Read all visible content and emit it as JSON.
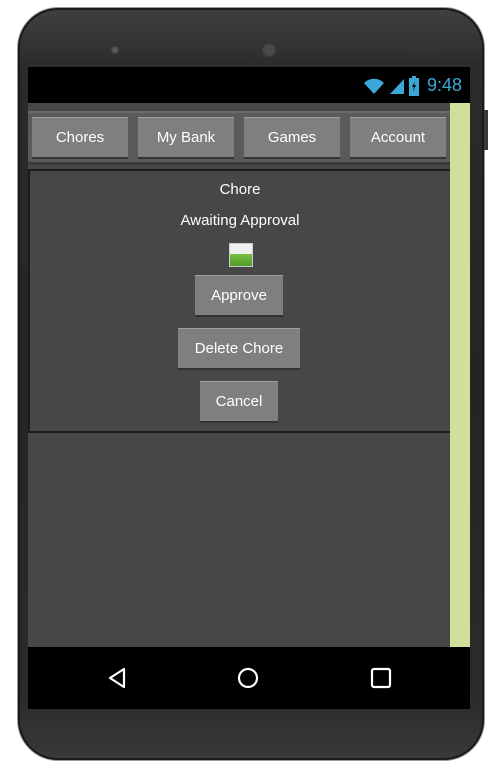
{
  "status": {
    "time": "9:48"
  },
  "nav": {
    "tabs": [
      "Chores",
      "My Bank",
      "Games",
      "Account"
    ]
  },
  "chore": {
    "name": "Chore",
    "status": "Awaiting Approval",
    "actions": {
      "approve": "Approve",
      "delete": "Delete Chore",
      "cancel": "Cancel"
    }
  },
  "icons": [
    "wifi-icon",
    "cell-signal-icon",
    "battery-icon",
    "image-icon",
    "back-icon",
    "home-icon",
    "recents-icon"
  ],
  "colors": {
    "accent": "#3aa9d8",
    "side_bar": "#cfe09c",
    "button": "#7f7f7f",
    "background": "#474747"
  }
}
